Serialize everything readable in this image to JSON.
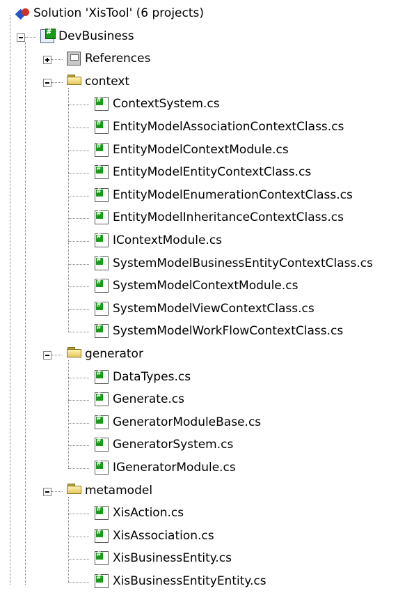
{
  "solution": {
    "label": "Solution 'XisTool' (6 projects)",
    "icon": "solution-icon"
  },
  "project": {
    "label": "DevBusiness",
    "icon": "csharp-project-icon",
    "expanded": true
  },
  "references": {
    "label": "References",
    "icon": "references-icon",
    "expanded": false
  },
  "folders": [
    {
      "label": "context",
      "expanded": true,
      "files": [
        "ContextSystem.cs",
        "EntityModelAssociationContextClass.cs",
        "EntityModelContextModule.cs",
        "EntityModelEntityContextClass.cs",
        "EntityModelEnumerationContextClass.cs",
        "EntityModelInheritanceContextClass.cs",
        "IContextModule.cs",
        "SystemModelBusinessEntityContextClass.cs",
        "SystemModelContextModule.cs",
        "SystemModelViewContextClass.cs",
        "SystemModelWorkFlowContextClass.cs"
      ]
    },
    {
      "label": "generator",
      "expanded": true,
      "files": [
        "DataTypes.cs",
        "Generate.cs",
        "GeneratorModuleBase.cs",
        "GeneratorSystem.cs",
        "IGeneratorModule.cs"
      ]
    },
    {
      "label": "metamodel",
      "expanded": true,
      "files": [
        "XisAction.cs",
        "XisAssociation.cs",
        "XisBusinessEntity.cs",
        "XisBusinessEntityEntity.cs"
      ]
    }
  ]
}
